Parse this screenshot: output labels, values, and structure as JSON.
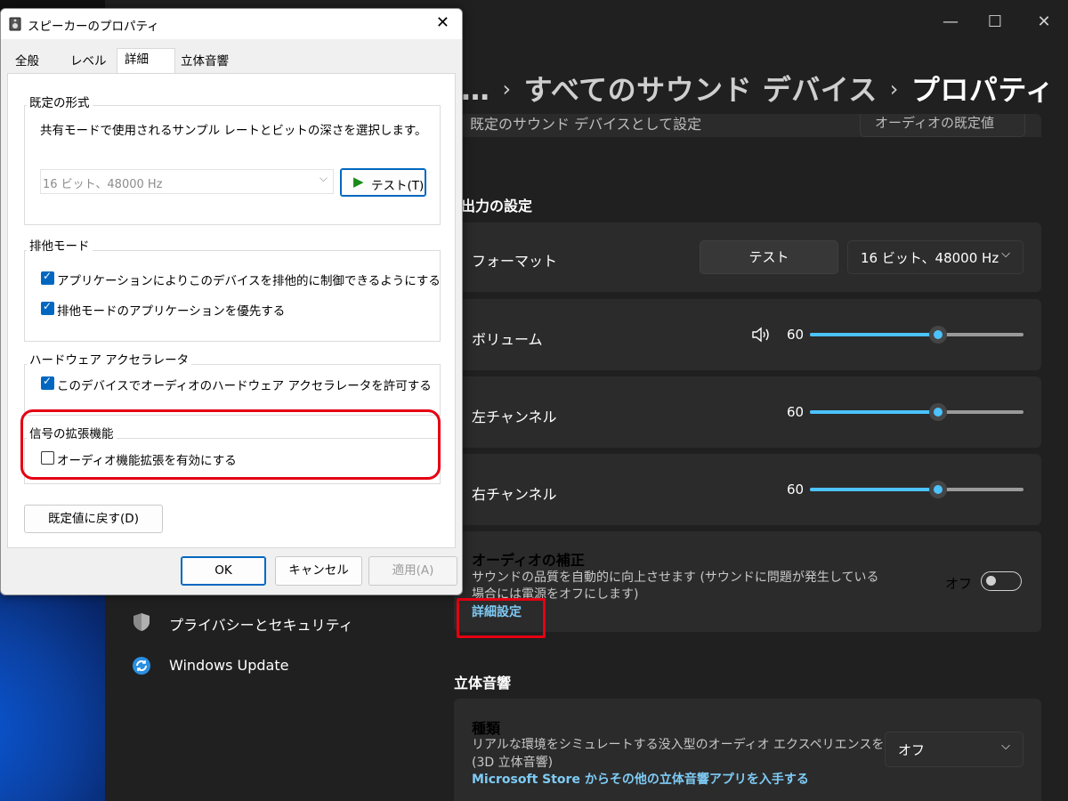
{
  "settings": {
    "window_controls": {
      "minimize": "—",
      "maximize": "☐",
      "close": "✕"
    },
    "breadcrumb": {
      "ellipsis": "…",
      "parent": "すべてのサウンド デバイス",
      "current": "プロパティ"
    },
    "partial_row": {
      "label": "既定のサウンド デバイスとして設定",
      "value": "オーディオの既定値"
    },
    "output_section_title": "出力の設定",
    "format_row": {
      "label": "フォーマット",
      "test_button": "テスト",
      "format_value": "16 ビット、48000 Hz"
    },
    "volume_row": {
      "label": "ボリューム",
      "value": "60",
      "level": 60
    },
    "left_channel_row": {
      "label": "左チャンネル",
      "value": "60",
      "level": 60
    },
    "right_channel_row": {
      "label": "右チャンネル",
      "value": "60",
      "level": 60
    },
    "enhance_row": {
      "title": "オーディオの補正",
      "desc_line1": "サウンドの品質を自動的に向上させます (サウンドに問題が発生している",
      "desc_line2": "場合には電源をオフにします)",
      "link": "詳細設定",
      "toggle_label": "オフ",
      "toggle_on": false
    },
    "spatial_section_title": "立体音響",
    "spatial_row": {
      "title": "種類",
      "desc_line1": "リアルな環境をシミュレートする没入型のオーディオ エクスペリエンスを選択する",
      "desc_line2": "(3D 立体音響)",
      "link": "Microsoft Store からその他の立体音響アプリを入手する",
      "select_value": "オフ"
    },
    "nav": [
      {
        "label": "プライバシーとセキュリティ",
        "icon": "shield-icon"
      },
      {
        "label": "Windows Update",
        "icon": "sync-icon"
      }
    ],
    "colors": {
      "accent": "#4cc2ff",
      "link": "#7ecbf5",
      "highlight": "#e50012"
    }
  },
  "dialog": {
    "title": "スピーカーのプロパティ",
    "close": "✕",
    "tabs": [
      "全般",
      "レベル",
      "詳細",
      "立体音響"
    ],
    "active_tab": "詳細",
    "default_format": {
      "group_label": "既定の形式",
      "description": "共有モードで使用されるサンプル レートとビットの深さを選択します。",
      "format_value": "16 ビット、48000 Hz",
      "test_button": "テスト(T)"
    },
    "exclusive_mode": {
      "group_label": "排他モード",
      "options": [
        {
          "label": "アプリケーションによりこのデバイスを排他的に制御できるようにする",
          "checked": true
        },
        {
          "label": "排他モードのアプリケーションを優先する",
          "checked": true
        }
      ]
    },
    "hardware_acceleration": {
      "group_label": "ハードウェア アクセラレータ",
      "option": {
        "label": "このデバイスでオーディオのハードウェア アクセラレータを許可する",
        "checked": true
      }
    },
    "signal_enhancements": {
      "group_label": "信号の拡張機能",
      "option": {
        "label": "オーディオ機能拡張を有効にする",
        "checked": false
      }
    },
    "restore_defaults_button": "既定値に戻す(D)",
    "ok_button": "OK",
    "cancel_button": "キャンセル",
    "apply_button": "適用(A)"
  }
}
